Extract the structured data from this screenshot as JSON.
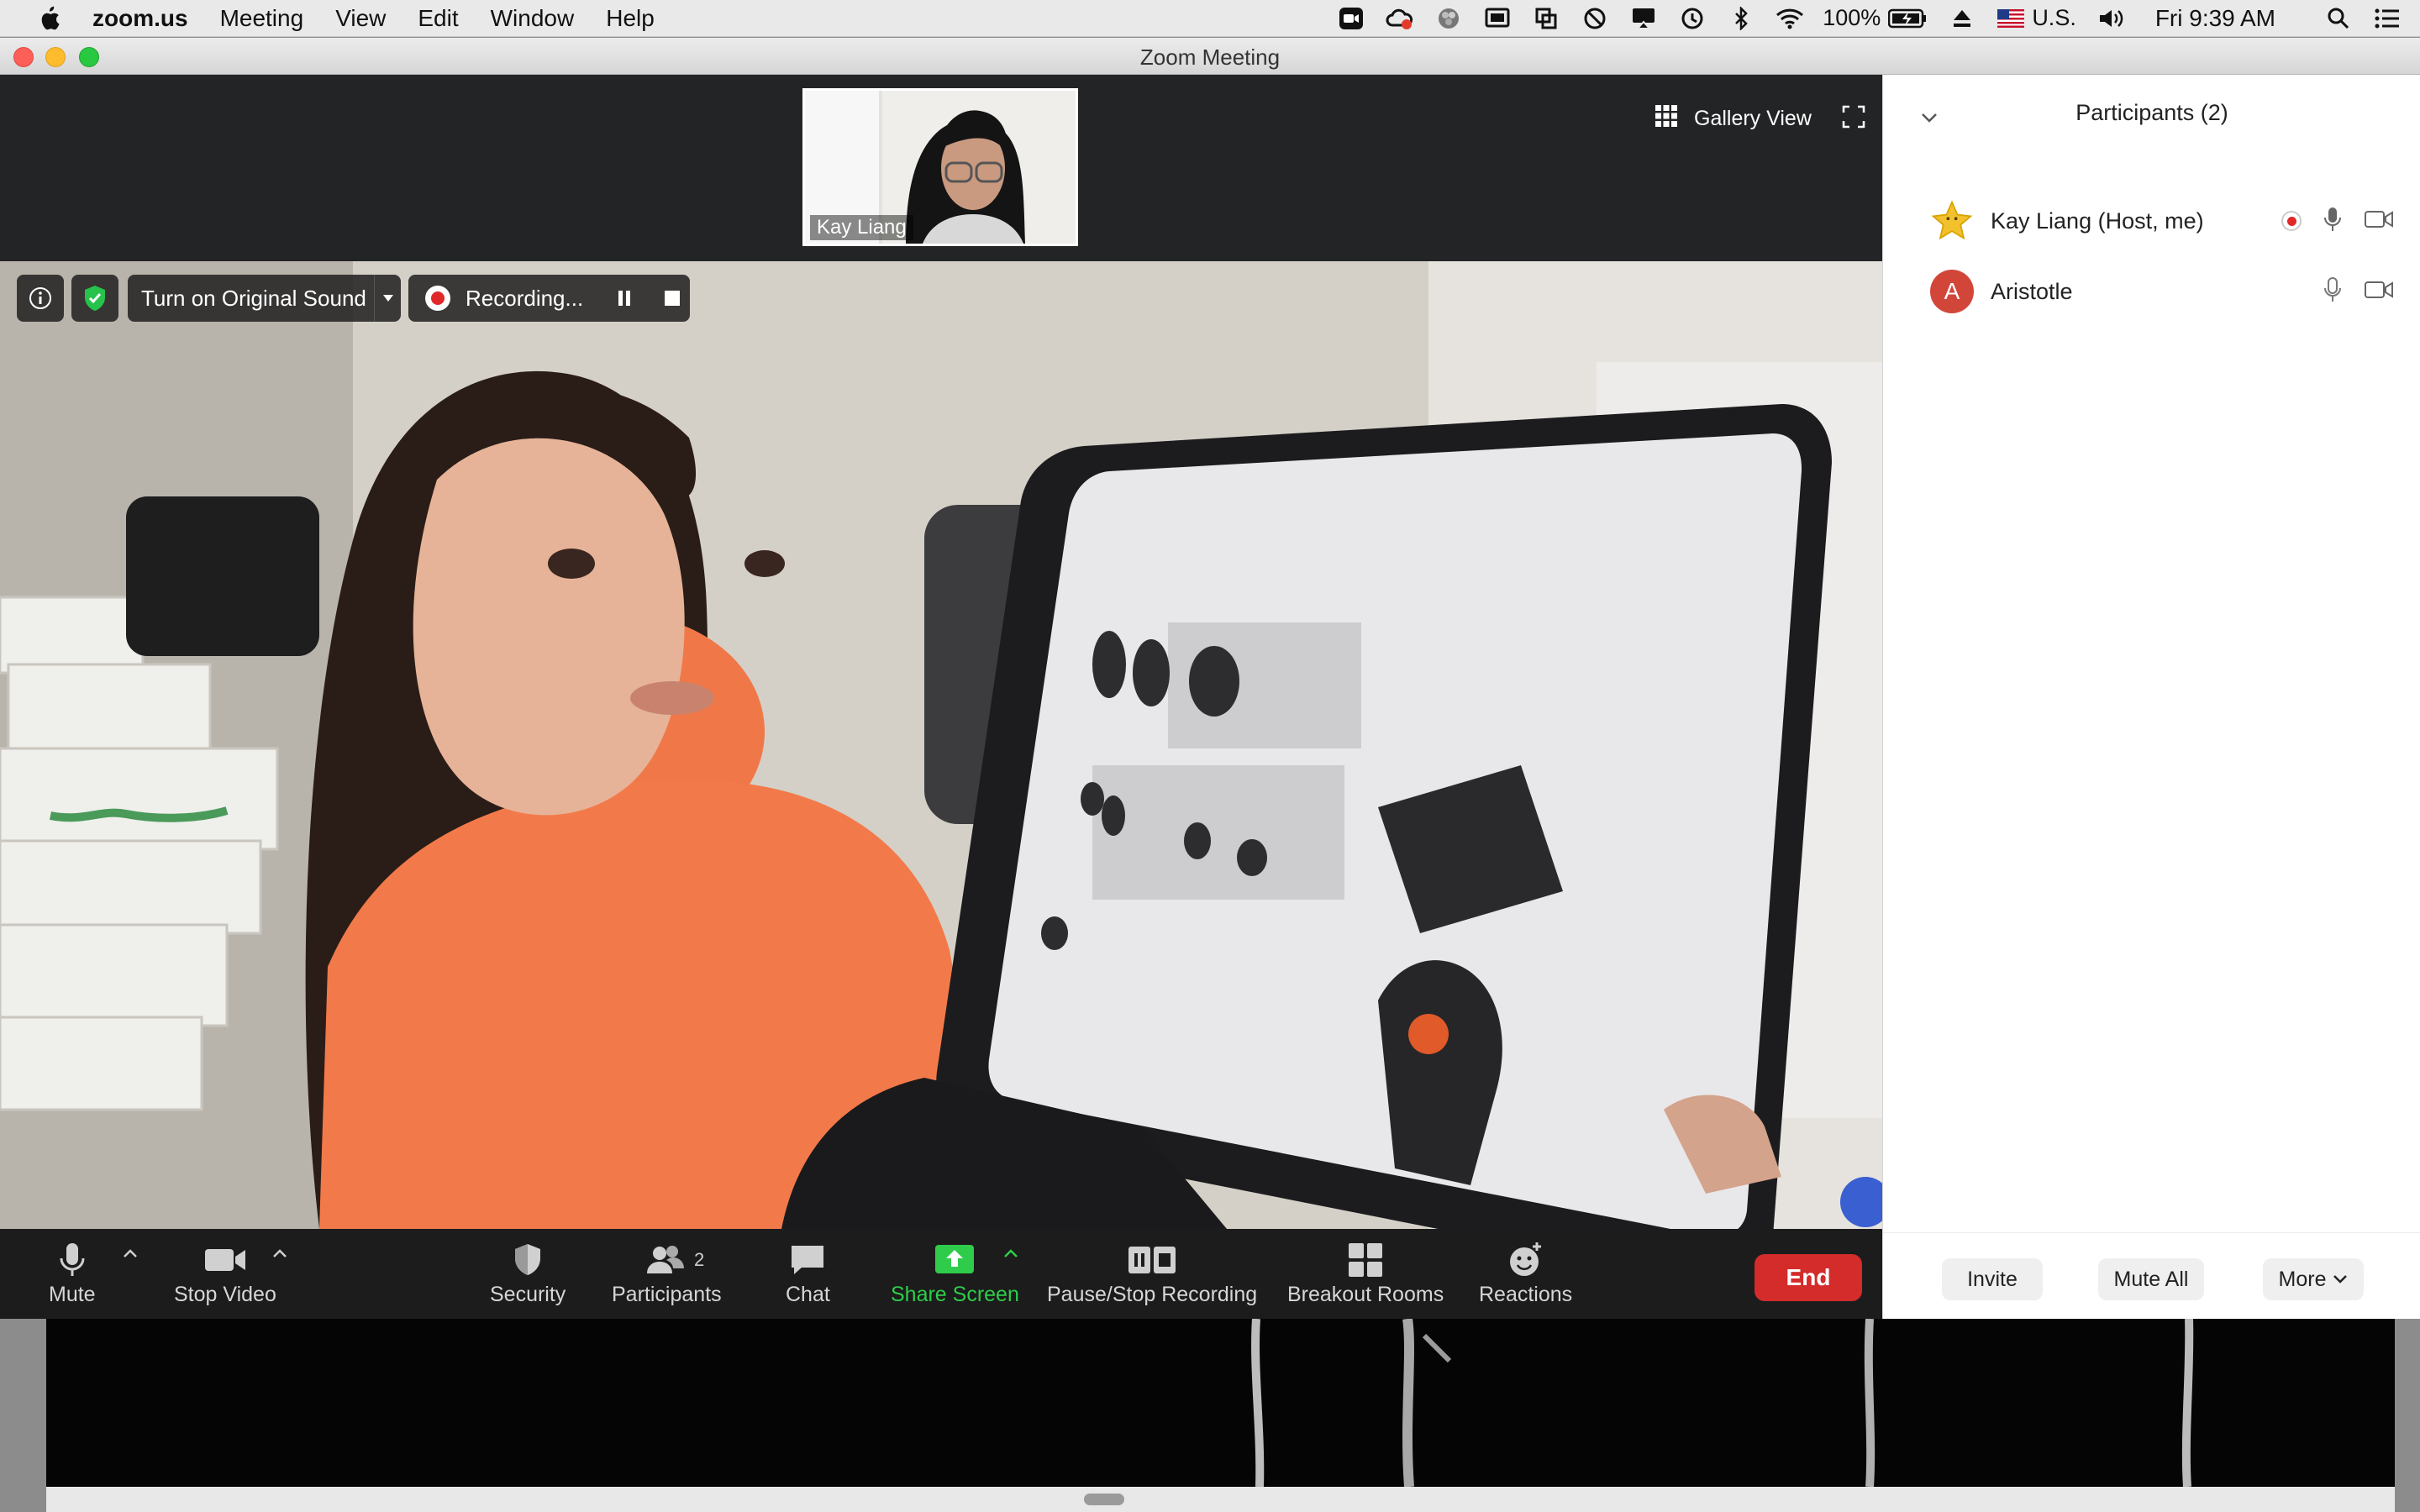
{
  "menubar": {
    "app_name": "zoom.us",
    "menus": [
      "Meeting",
      "View",
      "Edit",
      "Window",
      "Help"
    ],
    "battery_percent": "100%",
    "input_source": "U.S.",
    "clock": "Fri 9:39 AM"
  },
  "window": {
    "title": "Zoom Meeting"
  },
  "meeting": {
    "thumbnail_name": "Kay Liang",
    "gallery_view_label": "Gallery View",
    "original_sound_label": "Turn on Original Sound",
    "recording_label": "Recording..."
  },
  "toolbar": {
    "mute": "Mute",
    "stop_video": "Stop Video",
    "security": "Security",
    "participants": "Participants",
    "participants_count": "2",
    "chat": "Chat",
    "share_screen": "Share Screen",
    "pause_stop_recording": "Pause/Stop Recording",
    "breakout_rooms": "Breakout Rooms",
    "reactions": "Reactions",
    "end": "End"
  },
  "participants_panel": {
    "title": "Participants (2)",
    "participants": [
      {
        "name": "Kay Liang (Host, me)",
        "avatar": "star-avatar",
        "recording": true
      },
      {
        "name": "Aristotle",
        "avatar_letter": "A",
        "recording": false
      }
    ],
    "invite": "Invite",
    "mute_all": "Mute All",
    "more": "More"
  },
  "colors": {
    "share_green": "#2ecc4a",
    "end_red": "#d42b2b",
    "recording_red": "#e02828",
    "security_green": "#27c24c",
    "avatar_red": "#d2463a"
  }
}
